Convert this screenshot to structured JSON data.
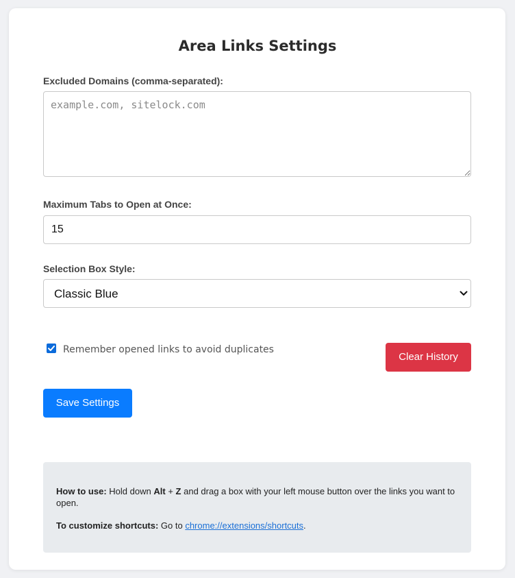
{
  "page": {
    "title": "Area Links Settings"
  },
  "excluded_domains": {
    "label": "Excluded Domains (comma-separated):",
    "value": "",
    "placeholder": "example.com, sitelock.com"
  },
  "max_tabs": {
    "label": "Maximum Tabs to Open at Once:",
    "value": "15"
  },
  "selection_style": {
    "label": "Selection Box Style:",
    "selected": "Classic Blue",
    "icon": "chevron-down-icon"
  },
  "remember_links": {
    "label": "Remember opened links to avoid duplicates",
    "checked": true
  },
  "buttons": {
    "clear_history": "Clear History",
    "save_settings": "Save Settings"
  },
  "help": {
    "how_to_use_label": "How to use:",
    "how_to_use_text_1": "Hold down",
    "key_1": "Alt",
    "plus": "+",
    "key_2": "Z",
    "how_to_use_text_2": "and drag a box with your left mouse button over the links you want to open.",
    "shortcuts_label": "To customize shortcuts:",
    "shortcuts_text": "Go to",
    "shortcuts_link": "chrome://extensions/shortcuts",
    "shortcuts_end": "."
  },
  "colors": {
    "primary": "#0a7cff",
    "danger": "#dc3545",
    "checkbox": "#0b6bdb",
    "info_bg": "#e8ebee"
  }
}
